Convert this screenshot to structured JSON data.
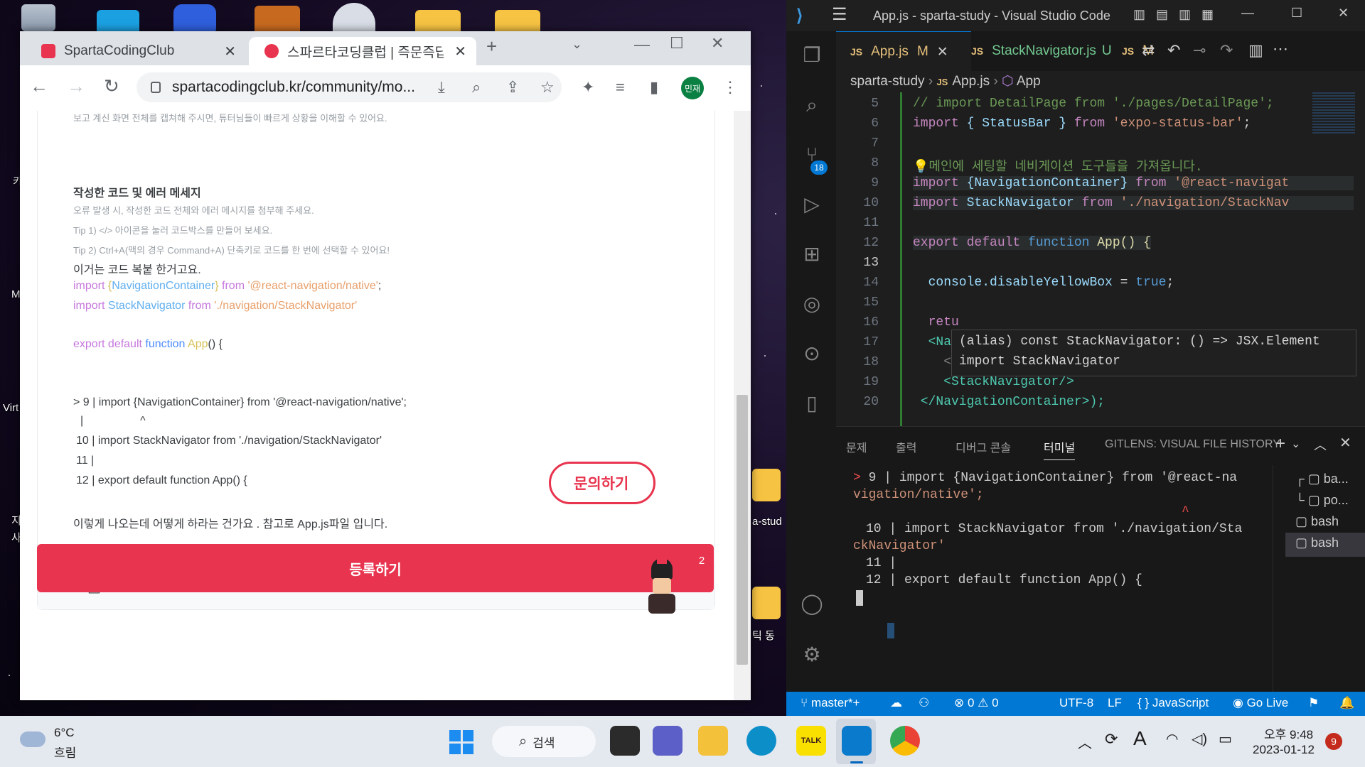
{
  "chrome": {
    "tabs": [
      {
        "title": "SpartaCodingClub",
        "active": false
      },
      {
        "title": "스파르타코딩클럽 | 즉문즉답",
        "active": true
      }
    ],
    "url": "spartacodingclub.kr/community/mo...",
    "profile_label": "민재"
  },
  "post": {
    "top_hint": "보고 계신 화면 전체를 캡쳐해 주시면, 튜터님들이 빠르게 상황을 이해할 수 있어요.",
    "section_title": "작성한 코드 및 에러 메세지",
    "help_1": "오류 발생 시, 작성한 코드 전체와 에러 메시지를 첨부해 주세요.",
    "help_2": "Tip 1) </> 아이콘을 눌러 코드박스를 만들어 보세요.",
    "help_3": "Tip 2) Ctrl+A(맥의 경우 Command+A) 단축키로 코드를 한 번에 선택할 수 있어요!",
    "user_line": "이거는 코드 복붙 한거고요.",
    "code": {
      "l1_import": "import",
      "l1_brace_open": " {",
      "l1_name": "NavigationContainer",
      "l1_brace_close": "}",
      "l1_from": " from ",
      "l1_str": "'@react-navigation/native'",
      "l1_semi": ";",
      "l2_import": "import",
      "l2_name": " StackNavigator",
      "l2_from": " from ",
      "l2_str": "'./navigation/StackNavigator'",
      "l3_kw": "export default ",
      "l3_fn": "function",
      "l3_name": " App",
      "l3_paren": "()",
      "l3_brace": " {"
    },
    "err_1": "> 9 | import {NavigationContainer} from '@react-navigation/native';",
    "err_2": "|                  ^",
    "err_3": "10 | import StackNavigator from './navigation/StackNavigator'",
    "err_4": "11 |",
    "err_5": "12 | export default function App() {",
    "closing": "이렇게 나오는데 어떻게 하라는 건가요 . 참고로 App.js파일 입니다.",
    "inquiry_label": "문의하기",
    "badge_count": "2",
    "register_label": "등록하기"
  },
  "vscode": {
    "title": "App.js - sparta-study - Visual Studio Code",
    "tabs": [
      {
        "name": "App.js",
        "status": "M"
      },
      {
        "name": "StackNavigator.js",
        "status": "U"
      },
      {
        "name": "",
        "status": "M"
      }
    ],
    "breadcrumb": [
      "sparta-study",
      "App.js",
      "App"
    ],
    "scm_badge": "18",
    "line_numbers": [
      "5",
      "6",
      "7",
      "8",
      "9",
      "10",
      "11",
      "12",
      "13",
      "14",
      "15",
      "16",
      "17",
      "18",
      "19",
      "20"
    ],
    "code_lines": {
      "l5": "// import DetailPage from './pages/DetailPage';",
      "l6a": "import",
      "l6b": " { StatusBar } ",
      "l6c": "from",
      "l6d": " 'expo-status-bar'",
      "l6e": ";",
      "l8": "💡메인에 세팅할 네비게이션 도구들을 가져옵니다.",
      "l9a": "import",
      "l9b": " {NavigationContainer} ",
      "l9c": "from",
      "l9d": " '@react-navigat",
      "l10a": "import",
      "l10b": " StackNavigator ",
      "l10c": "from",
      "l10d": " './navigation/StackNav",
      "l12a": "export default ",
      "l12b": "function",
      "l12c": " App",
      "l12d": "() {",
      "l14a": "  console.",
      "l14b": "disableYellowBox",
      "l14c": " = ",
      "l14d": "true",
      "l14e": ";",
      "l16": "  retu",
      "l17": "  <Na",
      "l18": "    <",
      "l19": "    <StackNavigator/>",
      "l20": " </NavigationContainer>);"
    },
    "hover_1": "(alias) const StackNavigator: () => JSX.Element",
    "hover_2": "import StackNavigator",
    "panel_tabs": [
      "문제",
      "출력",
      "디버그 콘솔",
      "터미널",
      "GITLENS: VISUAL FILE HISTORY"
    ],
    "terminal": {
      "t1": "9 | import {NavigationContainer} from '@react-na",
      "t2": "vigation/native';",
      "t3": "^",
      "t4": "10 | import StackNavigator from './navigation/Sta",
      "t5": "ckNavigator'",
      "t6": "11 |",
      "t7": "12 | export default function App() {"
    },
    "terminal_list": [
      "ba...",
      "po...",
      "bash",
      "bash"
    ],
    "status": {
      "branch": "master*+",
      "errors": "0",
      "warnings": "0",
      "encoding": "UTF-8",
      "eol": "LF",
      "language": "JavaScript",
      "golive": "Go Live"
    }
  },
  "desktop": {
    "labels": [
      "a-stud",
      "Virt",
      "M",
      "카",
      "지",
      "사",
      "틱 동"
    ]
  },
  "taskbar": {
    "weather_temp": "6°C",
    "weather_desc": "흐림",
    "search_label": "검색",
    "time": "오후 9:48",
    "date": "2023-01-12",
    "notification_count": "9"
  }
}
